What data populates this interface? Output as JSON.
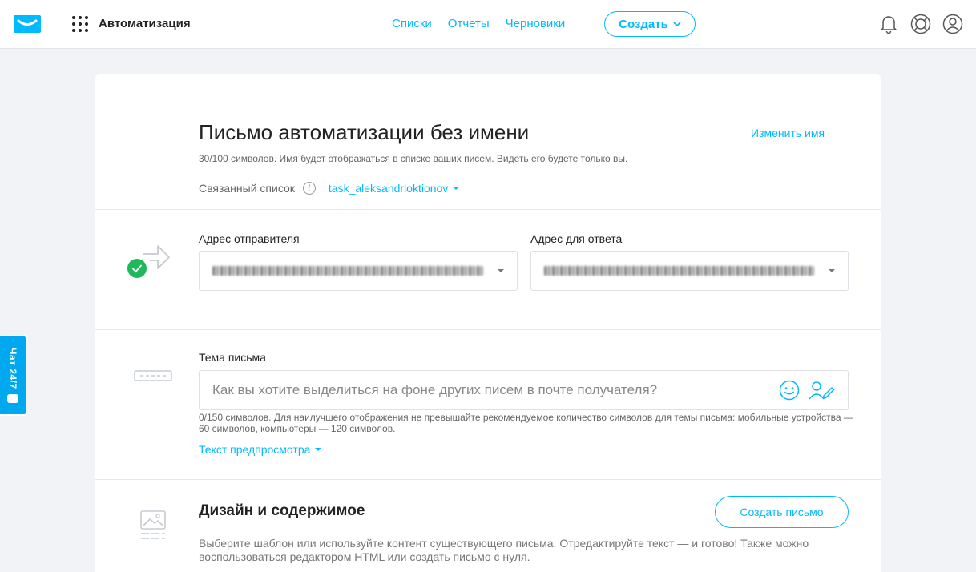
{
  "header": {
    "app_title": "Автоматизация",
    "nav": [
      "Списки",
      "Отчеты",
      "Черновики"
    ],
    "create_label": "Создать"
  },
  "chat": {
    "label": "Чат 24/7"
  },
  "message": {
    "title": "Письмо автоматизации без имени",
    "rename_label": "Изменить имя",
    "name_hint": "30/100 символов. Имя будет отображаться в списке ваших писем. Видеть его будете только вы.",
    "linked_list_label": "Связанный список",
    "linked_list_value": "task_aleksandrloktionov"
  },
  "sender": {
    "from_label": "Адрес отправителя",
    "reply_label": "Адрес для ответа"
  },
  "subject": {
    "label": "Тема письма",
    "placeholder": "Как вы хотите выделиться на фоне других писем в почте получателя?",
    "hint": "0/150 символов. Для наилучшего отображения не превышайте рекомендуемое количество символов для темы письма: мобильные устройства — 60 символов, компьютеры — 120 символов.",
    "preview_label": "Текст предпросмотра"
  },
  "design": {
    "title": "Дизайн и содержимое",
    "button_label": "Создать письмо",
    "hint": "Выберите шаблон или используйте контент существующего письма. Отредактируйте текст — и готово! Также можно воспользоваться редактором HTML или создать письмо с нуля."
  },
  "colors": {
    "accent": "#00baff",
    "success": "#1fb85a",
    "chat_bg": "#00a8f0"
  },
  "icons": [
    "envelope-logo-icon",
    "apps-grid-icon",
    "chevron-down-icon",
    "bell-icon",
    "lifebuoy-icon",
    "user-icon",
    "chat-bubble-icon",
    "info-icon",
    "check-icon",
    "arrow-right-icon",
    "subject-bar-icon",
    "smile-icon",
    "personalize-icon",
    "image-template-icon"
  ]
}
